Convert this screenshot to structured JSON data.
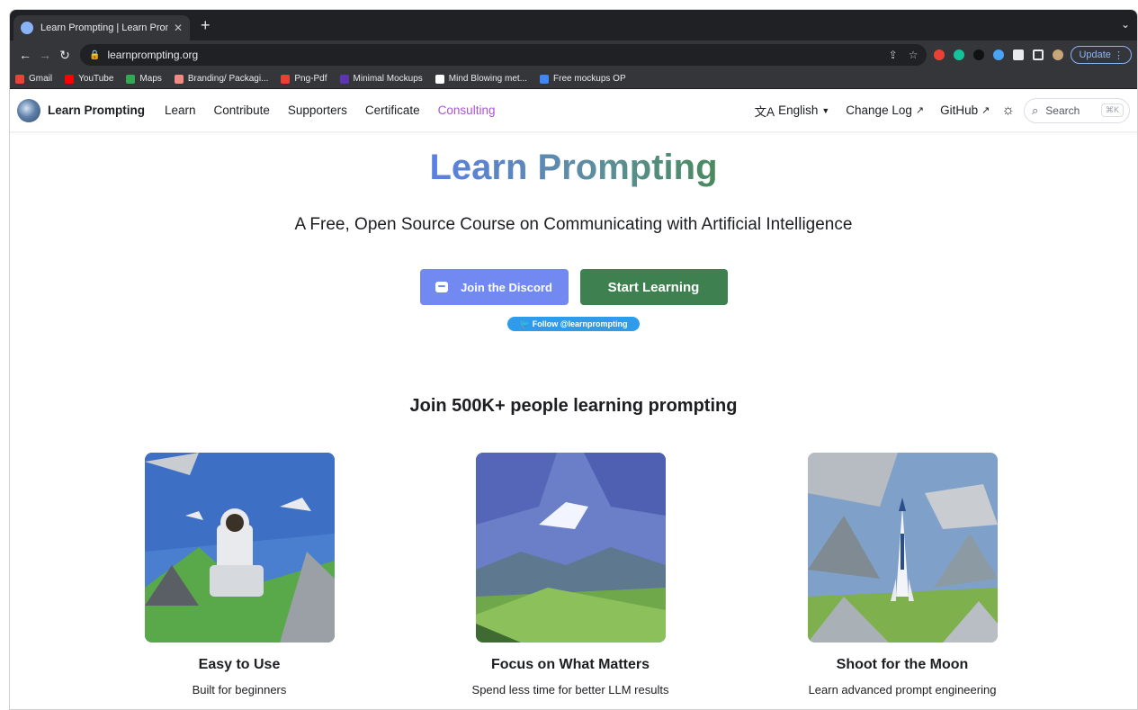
{
  "browser": {
    "tab_title": "Learn Prompting | Learn Promp",
    "url": "learnprompting.org",
    "update_label": "Update",
    "bookmarks": [
      {
        "label": "Gmail",
        "color": "#ea4335"
      },
      {
        "label": "YouTube",
        "color": "#ff0000"
      },
      {
        "label": "Maps",
        "color": "#34a853"
      },
      {
        "label": "Branding/ Packagi...",
        "color": "#f28b82"
      },
      {
        "label": "Png-Pdf",
        "color": "#e94235"
      },
      {
        "label": "Minimal Mockups",
        "color": "#5e35b1"
      },
      {
        "label": "Mind Blowing met...",
        "color": "#ffffff"
      },
      {
        "label": "Free mockups OP",
        "color": "#4285f4"
      }
    ]
  },
  "nav": {
    "brand": "Learn Prompting",
    "links": [
      "Learn",
      "Contribute",
      "Supporters",
      "Certificate",
      "Consulting"
    ],
    "language": "English",
    "changelog": "Change Log",
    "github": "GitHub",
    "search_label": "Search",
    "search_shortcut": "⌘K"
  },
  "hero": {
    "title": "Learn Prompting",
    "subtitle": "A Free, Open Source Course on Communicating with Artificial Intelligence",
    "discord_label": "Join the Discord",
    "start_label": "Start Learning",
    "follow_label": "Follow @learnprompting",
    "join_text": "Join 500K+ people learning prompting"
  },
  "features": [
    {
      "title": "Easy to Use",
      "desc": "Built for beginners"
    },
    {
      "title": "Focus on What Matters",
      "desc": "Spend less time for better LLM results"
    },
    {
      "title": "Shoot for the Moon",
      "desc": "Learn advanced prompt engineering"
    }
  ],
  "colors": {
    "consulting": "#a855d6",
    "discord": "#7289f2",
    "start": "#3f8050",
    "twitter": "#2f9ceb"
  }
}
